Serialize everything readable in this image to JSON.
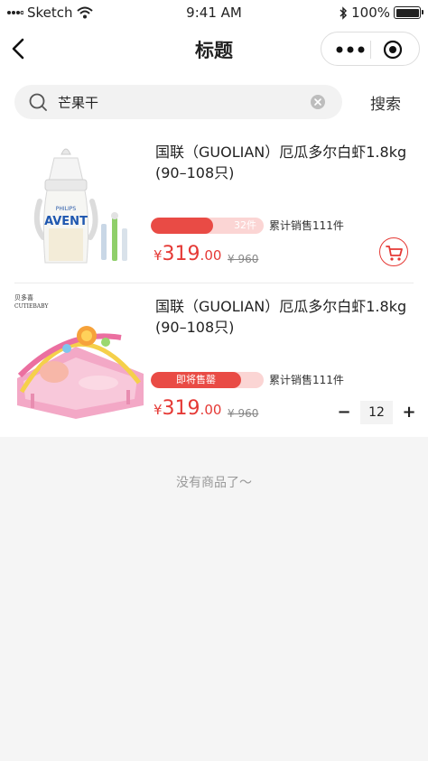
{
  "status_bar": {
    "carrier": "Sketch",
    "time": "9:41 AM",
    "battery": "100%"
  },
  "nav": {
    "title": "标题"
  },
  "search": {
    "value": "芒果干",
    "button_label": "搜索"
  },
  "products": [
    {
      "title": "国联（GUOLIAN）厄瓜多尔白虾1.8kg (90–108只)",
      "progress_label": "32件",
      "progress_fraction": 0.55,
      "sold_text": "累计销售111件",
      "price_currency": "¥",
      "price_int": "319",
      "price_dec": ".00",
      "original_price": "¥ 960",
      "image_brand": "PHILIPS",
      "image_subbrand": "AVENT"
    },
    {
      "title": "国联（GUOLIAN）厄瓜多尔白虾1.8kg (90–108只)",
      "progress_label": "即将售罄",
      "progress_fraction": 0.8,
      "sold_text": "累计销售111件",
      "price_currency": "¥",
      "price_int": "319",
      "price_dec": ".00",
      "original_price": "¥ 960",
      "quantity": "12",
      "image_brand_cn": "贝多喜",
      "image_brand_en": "CUTIEBABY"
    }
  ],
  "footer": {
    "empty_text": "没有商品了～"
  },
  "colors": {
    "accent": "#e53935",
    "progress_fill": "#e94b45",
    "progress_track": "#fbd5d4"
  }
}
